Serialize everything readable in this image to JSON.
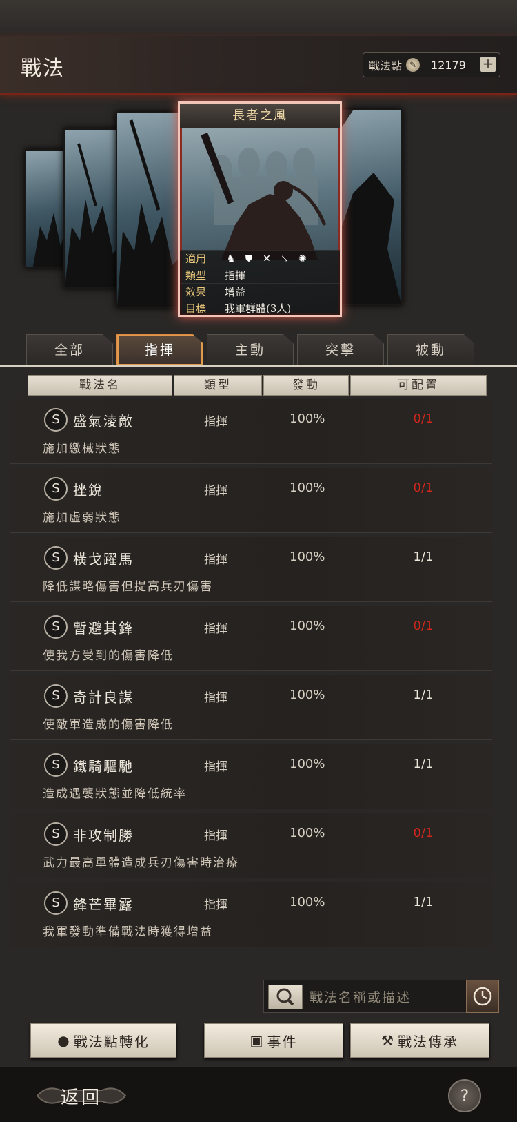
{
  "header": {
    "title": "戰法",
    "points_label": "戰法點",
    "points_value": "12179",
    "plus_label": "+"
  },
  "card": {
    "title": "長者之風",
    "info": [
      {
        "key": "適用",
        "value": ""
      },
      {
        "key": "類型",
        "value": "指揮"
      },
      {
        "key": "效果",
        "value": "增益"
      },
      {
        "key": "目標",
        "value": "我軍群體(3人)"
      }
    ],
    "unit_icons": [
      "cavalry-icon",
      "shield-icon",
      "bow-icon",
      "spear-icon",
      "wheel-icon"
    ]
  },
  "tabs": [
    {
      "label": "全部",
      "active": false
    },
    {
      "label": "指揮",
      "active": true
    },
    {
      "label": "主動",
      "active": false
    },
    {
      "label": "突擊",
      "active": false
    },
    {
      "label": "被動",
      "active": false
    }
  ],
  "columns": [
    "戰法名",
    "類型",
    "發動",
    "可配置"
  ],
  "skills": [
    {
      "grade": "S",
      "name": "盛氣淩敵",
      "type": "指揮",
      "rate": "100%",
      "slot": "0/1",
      "full": true,
      "desc": "施加繳械狀態"
    },
    {
      "grade": "S",
      "name": "挫銳",
      "type": "指揮",
      "rate": "100%",
      "slot": "0/1",
      "full": true,
      "desc": "施加虛弱狀態"
    },
    {
      "grade": "S",
      "name": "橫戈躍馬",
      "type": "指揮",
      "rate": "100%",
      "slot": "1/1",
      "full": false,
      "desc": "降低謀略傷害但提高兵刃傷害"
    },
    {
      "grade": "S",
      "name": "暫避其鋒",
      "type": "指揮",
      "rate": "100%",
      "slot": "0/1",
      "full": true,
      "desc": "使我方受到的傷害降低"
    },
    {
      "grade": "S",
      "name": "奇計良謀",
      "type": "指揮",
      "rate": "100%",
      "slot": "1/1",
      "full": false,
      "desc": "使敵軍造成的傷害降低"
    },
    {
      "grade": "S",
      "name": "鐵騎驅馳",
      "type": "指揮",
      "rate": "100%",
      "slot": "1/1",
      "full": false,
      "desc": "造成遇襲狀態並降低統率"
    },
    {
      "grade": "S",
      "name": "非攻制勝",
      "type": "指揮",
      "rate": "100%",
      "slot": "0/1",
      "full": true,
      "desc": "武力最高單體造成兵刃傷害時治療"
    },
    {
      "grade": "S",
      "name": "鋒芒畢露",
      "type": "指揮",
      "rate": "100%",
      "slot": "1/1",
      "full": false,
      "desc": "我軍發動準備戰法時獲得增益"
    }
  ],
  "search": {
    "placeholder": "戰法名稱或描述"
  },
  "buttons": {
    "convert": "戰法點轉化",
    "events": "事件",
    "inherit": "戰法傳承"
  },
  "footer": {
    "back": "返回",
    "help": "?"
  },
  "colors": {
    "accent": "#e09a50",
    "red": "#d0261c",
    "title_bar": "#7a2418"
  }
}
